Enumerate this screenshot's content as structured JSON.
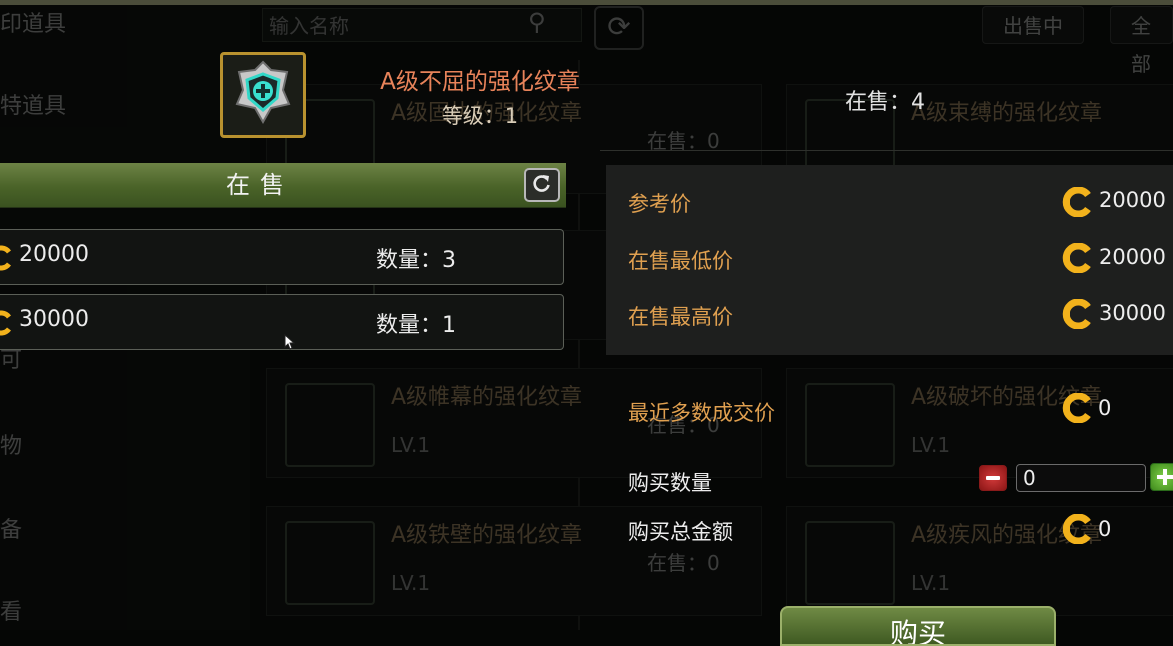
{
  "background": {
    "sidebar_items": [
      "印道具",
      "特道具",
      "可",
      "物",
      "备",
      "看"
    ],
    "search_placeholder": "输入名称",
    "filter_labels": [
      "出售中",
      "全部"
    ],
    "cards": [
      {
        "name": "A级固执的强化纹章",
        "level": "",
        "count": "在售：0"
      },
      {
        "name": "A级束缚的强化纹章",
        "level": "",
        "count": ""
      },
      {
        "name": "",
        "level": "",
        "count": ""
      },
      {
        "name": "",
        "level": "",
        "count": ""
      },
      {
        "name": "A级帷幕的强化纹章",
        "level": "LV.1",
        "count": "在售：0"
      },
      {
        "name": "A级破坏的强化纹章",
        "level": "LV.1",
        "count": ""
      },
      {
        "name": "A级铁壁的强化纹章",
        "level": "LV.1",
        "count": "在售：0"
      },
      {
        "name": "A级疾风的强化纹章",
        "level": "LV.1",
        "count": ""
      }
    ]
  },
  "item": {
    "icon": "shield-emblem-icon",
    "name": "A级不屈的强化纹章",
    "level": "等级：1",
    "on_sale": "在售：4"
  },
  "sale_section": {
    "title": "在售",
    "listings": [
      {
        "price": "20000",
        "quantity": "数量：3"
      },
      {
        "price": "30000",
        "quantity": "数量：1"
      }
    ]
  },
  "price_info": {
    "reference_label": "参考价",
    "reference_value": "20000",
    "lowest_label": "在售最低价",
    "lowest_value": "20000",
    "highest_label": "在售最高价",
    "highest_value": "30000"
  },
  "purchase": {
    "recent_label": "最近多数成交价",
    "recent_value": "0",
    "quantity_label": "购买数量",
    "quantity_value": "0",
    "total_label": "购买总金额",
    "total_value": "0",
    "buy_label": "购买"
  },
  "colors": {
    "accent_orange": "#e0a050",
    "item_name": "#e8835a",
    "coin": "#f2b21c",
    "green_bar": "#4a6328",
    "icon_frame": "#b9922f"
  }
}
